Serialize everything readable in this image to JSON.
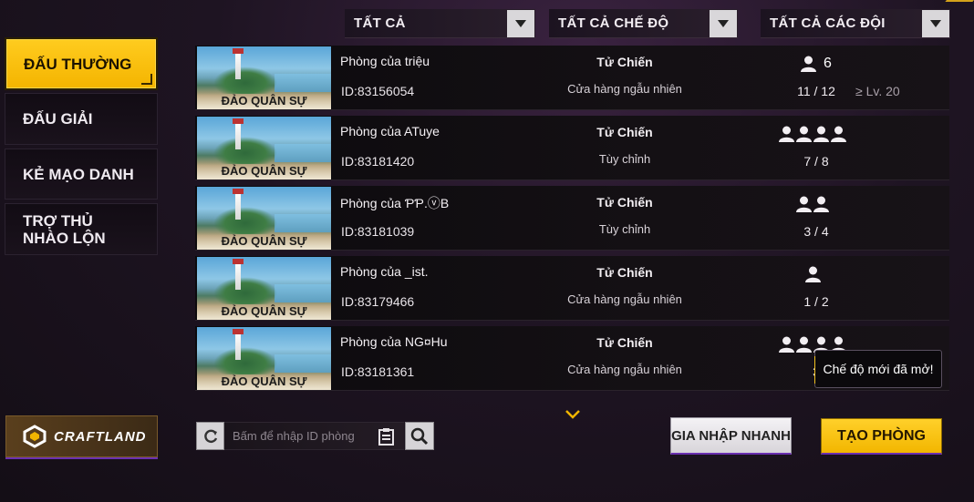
{
  "filters": [
    {
      "label": "TẤT CẢ"
    },
    {
      "label": "TẤT CẢ CHẾ ĐỘ"
    },
    {
      "label": "TẤT CẢ CÁC ĐỘI"
    }
  ],
  "tabs": [
    {
      "label": "ĐẤU THƯỜNG",
      "active": true
    },
    {
      "label": "ĐẤU GIẢI",
      "active": false
    },
    {
      "label": "KẺ MẠO DANH",
      "active": false
    },
    {
      "label": "TRỢ THỦ NHÀO LỘN",
      "active": false
    }
  ],
  "rooms": [
    {
      "map": "ĐẢO QUÂN SỰ",
      "name": "Phòng của triệu",
      "id": "ID:83156054",
      "mode": "Tử Chiến",
      "shop": "Cửa hàng ngẫu nhiên",
      "team_icons": 1,
      "team_count": "6",
      "players": "11 / 12",
      "level": "≥ Lv. 20"
    },
    {
      "map": "ĐẢO QUÂN SỰ",
      "name": "Phòng của ATuye",
      "id": "ID:83181420",
      "mode": "Tử Chiến",
      "shop": "Tùy chỉnh",
      "team_icons": 4,
      "team_count": "",
      "players": "7 / 8",
      "level": ""
    },
    {
      "map": "ĐẢO QUÂN SỰ",
      "name": "Phòng của ƤƤ.ⓥB",
      "id": "ID:83181039",
      "mode": "Tử Chiến",
      "shop": "Tùy chỉnh",
      "team_icons": 2,
      "team_count": "",
      "players": "3 / 4",
      "level": ""
    },
    {
      "map": "ĐẢO QUÂN SỰ",
      "name": "Phòng của _ist.",
      "id": "ID:83179466",
      "mode": "Tử Chiến",
      "shop": "Cửa hàng ngẫu nhiên",
      "team_icons": 1,
      "team_count": "",
      "players": "1 / 2",
      "level": ""
    },
    {
      "map": "ĐẢO QUÂN SỰ",
      "name": "Phòng của NG¤Hu",
      "id": "ID:83181361",
      "mode": "Tử Chiến",
      "shop": "Cửa hàng ngẫu nhiên",
      "team_icons": 4,
      "team_count": "",
      "players": "3",
      "level": ""
    }
  ],
  "tooltip": "Chế độ mới đã mở!",
  "craftland": {
    "label": "CRAFTLAND"
  },
  "search": {
    "placeholder": "Bấm để nhập ID phòng",
    "value": ""
  },
  "buttons": {
    "join": "GIA NHẬP NHANH",
    "create": "TẠO PHÒNG"
  },
  "colors": {
    "accent": "#f4b400",
    "highlight": "#6a2fb0",
    "panel": "#0c0a0d"
  },
  "icons": {
    "dropdown": "chevron-down-icon",
    "player": "person-icon",
    "refresh": "refresh-icon",
    "paste": "clipboard-icon",
    "search": "magnifier-icon",
    "more": "chevron-down-icon"
  }
}
